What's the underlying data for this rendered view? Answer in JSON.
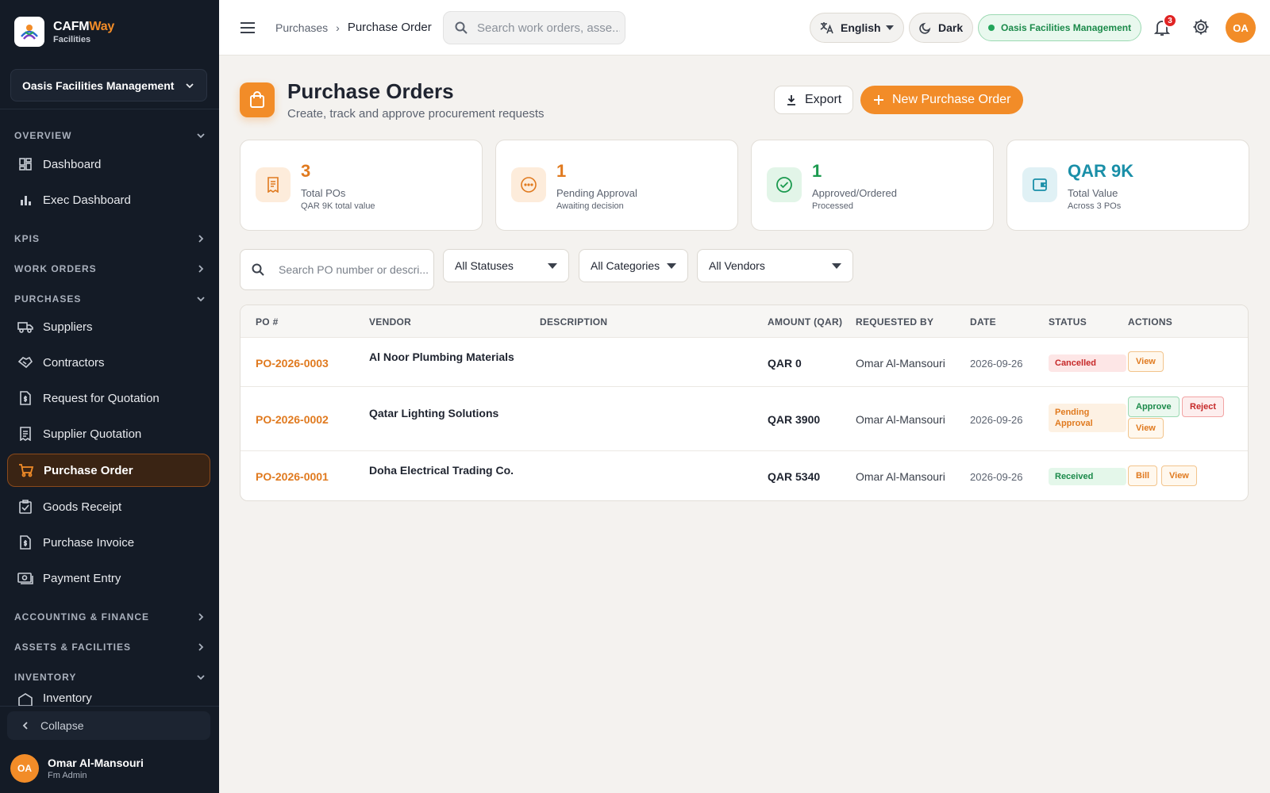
{
  "brand": {
    "name_part1": "CAFM",
    "name_part2": "Way",
    "sub": "Facilities"
  },
  "sidebar": {
    "org": "Oasis Facilities Management",
    "sections": {
      "overview": "OVERVIEW",
      "kpis": "KPIS",
      "work_orders": "WORK ORDERS",
      "purchases": "PURCHASES",
      "accounting": "ACCOUNTING & FINANCE",
      "assets": "ASSETS & FACILITIES",
      "inventory": "INVENTORY"
    },
    "items": {
      "dashboard": "Dashboard",
      "exec_dashboard": "Exec Dashboard",
      "suppliers": "Suppliers",
      "contractors": "Contractors",
      "rfq": "Request for Quotation",
      "supplier_quotation": "Supplier Quotation",
      "purchase_order": "Purchase Order",
      "goods_receipt": "Goods Receipt",
      "purchase_invoice": "Purchase Invoice",
      "payment_entry": "Payment Entry",
      "inventory": "Inventory"
    },
    "collapse": "Collapse",
    "user": {
      "initials": "OA",
      "name": "Omar Al-Mansouri",
      "role": "Fm Admin"
    }
  },
  "topbar": {
    "breadcrumb": {
      "parent": "Purchases",
      "current": "Purchase Order"
    },
    "search_placeholder": "Search work orders, asse...",
    "language": "English",
    "theme": "Dark",
    "org_status": "Oasis Facilities Management",
    "notifications": "3",
    "avatar": "OA"
  },
  "header": {
    "title": "Purchase Orders",
    "subtitle": "Create, track and approve procurement requests",
    "export": "Export",
    "new_po": "New Purchase Order"
  },
  "stats": [
    {
      "value": "3",
      "label": "Total POs",
      "note": "QAR 9K total value",
      "color": "#e07a1f"
    },
    {
      "value": "1",
      "label": "Pending Approval",
      "note": "Awaiting decision",
      "color": "#e07a1f"
    },
    {
      "value": "1",
      "label": "Approved/Ordered",
      "note": "Processed",
      "color": "#1b9a4f"
    },
    {
      "value": "QAR 9K",
      "label": "Total Value",
      "note": "Across 3 POs",
      "color": "#1a8fa8"
    }
  ],
  "filters": {
    "search_placeholder": "Search PO number or descri...",
    "status": "All Statuses",
    "category": "All Categories",
    "vendor": "All Vendors"
  },
  "table": {
    "columns": [
      "PO #",
      "VENDOR",
      "DESCRIPTION",
      "AMOUNT (QAR)",
      "REQUESTED BY",
      "DATE",
      "STATUS",
      "ACTIONS"
    ],
    "rows": [
      {
        "po": "PO-2026-0003",
        "vendor": "Al Noor Plumbing Materials",
        "description": "",
        "amount": "QAR 0",
        "requested_by": "Omar Al-Mansouri",
        "date": "2026-09-26",
        "status": "Cancelled",
        "actions": [
          "View"
        ]
      },
      {
        "po": "PO-2026-0002",
        "vendor": "Qatar Lighting Solutions",
        "description": "",
        "amount": "QAR 3900",
        "requested_by": "Omar Al-Mansouri",
        "date": "2026-09-26",
        "status_line1": "Pending",
        "status_line2": "Approval",
        "actions": [
          "Approve",
          "Reject",
          "View"
        ]
      },
      {
        "po": "PO-2026-0001",
        "vendor": "Doha Electrical Trading Co.",
        "description": "",
        "amount": "QAR 5340",
        "requested_by": "Omar Al-Mansouri",
        "date": "2026-09-26",
        "status": "Received",
        "actions": [
          "Bill",
          "View"
        ]
      }
    ]
  },
  "colors": {
    "accent": "#f28c28",
    "sidebar_bg": "#141b26",
    "page_bg": "#f4f2ef"
  }
}
